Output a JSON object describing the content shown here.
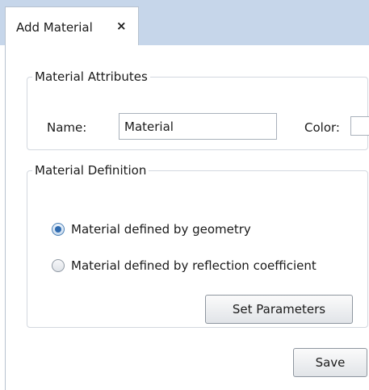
{
  "tab": {
    "label": "Add Material",
    "close_glyph": "×"
  },
  "attributes": {
    "legend": "Material Attributes",
    "name_label": "Name:",
    "name_value": "Material",
    "color_label": "Color:",
    "color_value": "#ffffff"
  },
  "definition": {
    "legend": "Material Definition",
    "options": [
      {
        "label": "Material defined by geometry",
        "checked": true
      },
      {
        "label": "Material defined by reflection coefficient",
        "checked": false
      }
    ],
    "set_params_label": "Set Parameters"
  },
  "footer": {
    "save_label": "Save"
  },
  "colors": {
    "tab_strip": "#c6d6ea",
    "radio_selected": "#2f6bb0"
  }
}
